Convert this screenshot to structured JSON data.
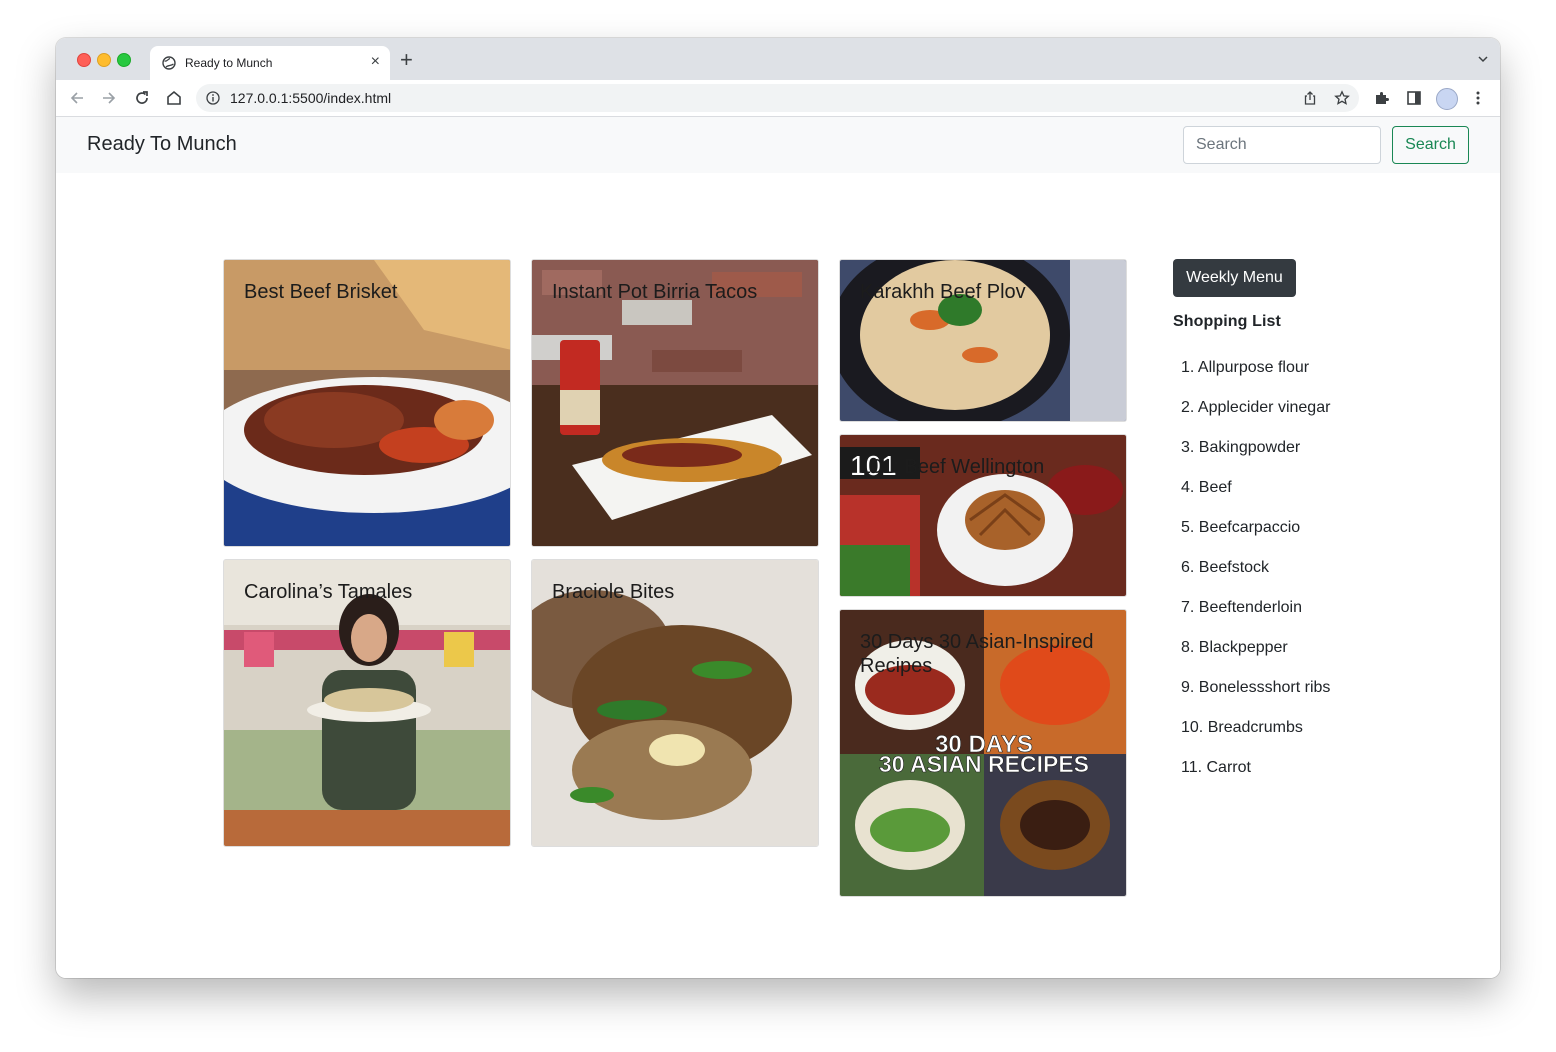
{
  "browser": {
    "tab_title": "Ready to Munch",
    "new_tab": "+",
    "close": "×",
    "url": "127.0.0.1:5500/index.html"
  },
  "navbar": {
    "brand": "Ready To Munch",
    "search_placeholder": "Search",
    "search_button": "Search"
  },
  "recipes": [
    {
      "title": "Best Beef Brisket"
    },
    {
      "title": "Instant Pot Birria Tacos"
    },
    {
      "title": "Karakhh Beef Plov"
    },
    {
      "title": "Carolina’s Tamales"
    },
    {
      "title": "Braciole Bites"
    },
    {
      "title": "101: Beef Wellington"
    },
    {
      "title": "30 Days 30 Asian-Inspired Recipes"
    }
  ],
  "image_text": {
    "wellington_badge": "101",
    "asian_line1": "30 DAYS",
    "asian_line2": "30 ASIAN RECIPES"
  },
  "sidebar": {
    "weekly_menu_button": "Weekly Menu",
    "shopping_list_title": "Shopping List",
    "items": [
      "1. Allpurpose flour",
      "2. Applecider vinegar",
      "3. Bakingpowder",
      "4. Beef",
      "5. Beefcarpaccio",
      "6. Beefstock",
      "7. Beeftenderloin",
      "8. Blackpepper",
      "9. Bonelessshort ribs",
      "10. Breadcrumbs",
      "11. Carrot"
    ]
  },
  "colors": {
    "navbar_bg": "#f8f9fa",
    "success": "#198754",
    "dark": "#343a40"
  }
}
